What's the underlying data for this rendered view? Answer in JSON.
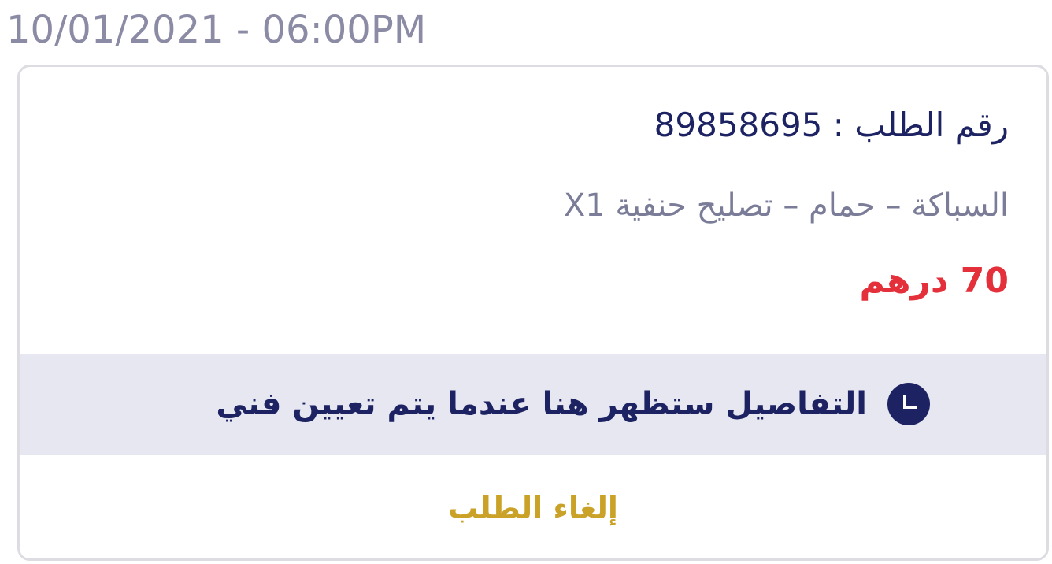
{
  "timestamp": "10/01/2021 - 06:00PM",
  "order": {
    "number_label": "رقم الطلب :",
    "number_value": "89858695",
    "service": "السباكة – حمام – تصليح حنفية X1",
    "price_value": "70",
    "price_currency": "درهم"
  },
  "banner": {
    "icon": "clock-icon",
    "text": "التفاصيل ستظهر هنا عندما يتم تعيين فني"
  },
  "actions": {
    "cancel_label": "إلغاء الطلب"
  },
  "colors": {
    "navy": "#1c2262",
    "price_red": "#e3303a",
    "cancel_gold": "#c9a227",
    "banner_bg": "#e6e7f0",
    "muted_text": "#7b7d98"
  }
}
